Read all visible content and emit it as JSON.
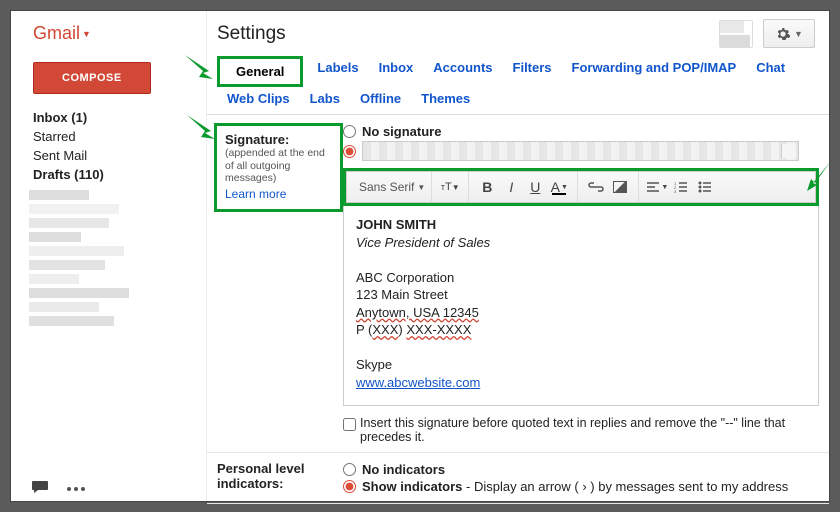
{
  "brand": "Gmail",
  "sidebar": {
    "compose": "COMPOSE",
    "folders": [
      {
        "label": "Inbox (1)",
        "bold": true
      },
      {
        "label": "Starred",
        "bold": false
      },
      {
        "label": "Sent Mail",
        "bold": false
      },
      {
        "label": "Drafts (110)",
        "bold": true
      }
    ]
  },
  "header": {
    "title": "Settings"
  },
  "tabs_row1": [
    "General",
    "Labels",
    "Inbox",
    "Accounts",
    "Filters",
    "Forwarding and POP/IMAP",
    "Chat"
  ],
  "tabs_row2": [
    "Web Clips",
    "Labs",
    "Offline",
    "Themes"
  ],
  "signature": {
    "section_title": "Signature:",
    "section_sub": "(appended at the end of all outgoing messages)",
    "learn_more": "Learn more",
    "no_sig": "No signature",
    "font": "Sans Serif",
    "body": {
      "name": "JOHN SMITH",
      "title": "Vice President of Sales",
      "company": "ABC Corporation",
      "street": "123 Main Street",
      "city": "Anytown, USA 12345",
      "phone_prefix": "P (",
      "phone_area": "XXX",
      "phone_mid": ") ",
      "phone_num": "XXX-XXXX",
      "skype": "Skype",
      "url": "www.abcwebsite.com"
    },
    "insert_before": "Insert this signature before quoted text in replies and remove the \"--\" line that precedes it."
  },
  "personal": {
    "title": "Personal level indicators:",
    "no_ind": "No indicators",
    "show_title": "Show indicators",
    "show_desc": " - Display an arrow ( › ) by messages sent to my address"
  }
}
